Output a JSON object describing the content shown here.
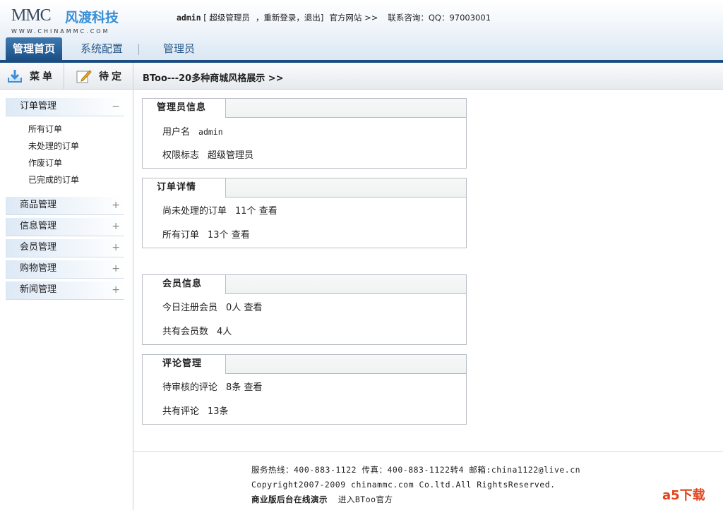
{
  "header": {
    "logo_en": "MMC",
    "logo_cn": "风渡科技",
    "logo_url": "WWW.CHINAMMC.COM",
    "user": "admin",
    "role_bracket": "[ 超级管理员",
    "relogin": "，重新登录",
    "logout": "，退出]",
    "official_site": "官方网站 >>",
    "contact": "联系咨询：QQ：97003001"
  },
  "tabs": [
    {
      "label": "管理首页"
    },
    {
      "label": "系统配置"
    },
    {
      "label": "管理员"
    }
  ],
  "toolbar": {
    "menu": "菜单",
    "pending": "待定",
    "crumb": "BToo---20多种商城风格展示 >>"
  },
  "sidebar": {
    "groups": [
      {
        "label": "订单管理",
        "sign": "−",
        "items": [
          "所有订单",
          "未处理的订单",
          "作废订单",
          "已完成的订单"
        ]
      },
      {
        "label": "商品管理",
        "sign": "+"
      },
      {
        "label": "信息管理",
        "sign": "+"
      },
      {
        "label": "会员管理",
        "sign": "+"
      },
      {
        "label": "购物管理",
        "sign": "+"
      },
      {
        "label": "新闻管理",
        "sign": "+"
      }
    ]
  },
  "panels": [
    {
      "title": "管理员信息",
      "rows": [
        {
          "label": "用户名",
          "value": "admin"
        },
        {
          "label": "权限标志",
          "value": "超级管理员"
        }
      ]
    },
    {
      "title": "订单详情",
      "rows": [
        {
          "label": "尚未处理的订单",
          "value": "11个",
          "link": "查看"
        },
        {
          "label": "所有订单",
          "value": "13个",
          "link": "查看"
        }
      ]
    },
    {
      "title": "会员信息",
      "rows": [
        {
          "label": "今日注册会员",
          "value": "0人",
          "link": "查看"
        },
        {
          "label": "共有会员数",
          "value": "4人"
        }
      ]
    },
    {
      "title": "评论管理",
      "rows": [
        {
          "label": "待审核的评论",
          "value": "8条",
          "link": "查看"
        },
        {
          "label": "共有评论",
          "value": "13条"
        }
      ]
    }
  ],
  "footer": {
    "line1": "服务热线：400-883-1122  传真：400-883-1122转4  邮箱:china1122@live.cn",
    "line2": "Copyright2007-2009 chinammc.com Co.ltd.All RightsReserved.",
    "demo": "商业版后台在线演示",
    "enter": "进入BToo官方"
  },
  "watermark": "a5下载"
}
